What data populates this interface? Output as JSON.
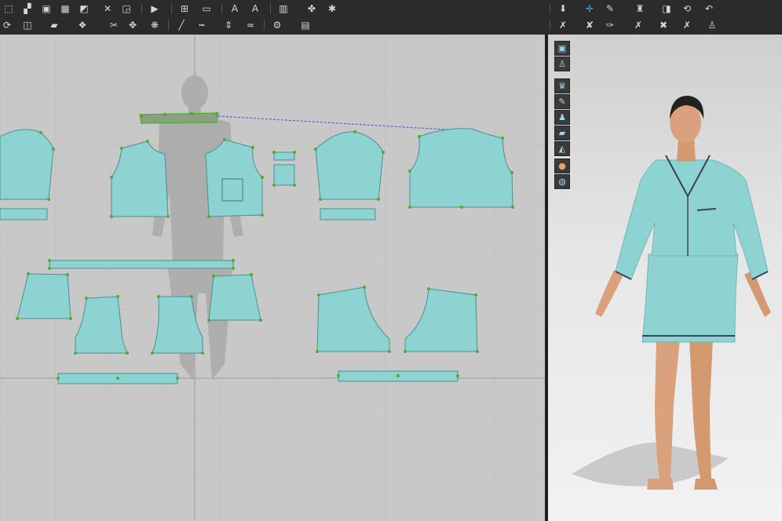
{
  "app": {
    "accent_color": "#3fb6e0",
    "fabric_color": "#8dd3d1",
    "piping_color": "#3a3f63",
    "point_color": "#4cae2a"
  },
  "toolbar": {
    "row1": [
      "select-icon",
      "move-icon",
      "image-icon",
      "grid-icon",
      "edit-point-icon",
      "cut-icon",
      "trace-icon",
      "fold-icon",
      "ruler-icon",
      "measure-icon",
      "text-icon",
      "font-icon",
      "notch-icon",
      "brush-icon",
      "bug-icon",
      "arrow-down-icon",
      "add-point-icon",
      "pin-icon",
      "garment-icon",
      "layer-icon",
      "rotate-icon",
      "undo-icon"
    ],
    "row2": [
      "wrap-icon",
      "rotate-piece-icon",
      "shirt-icon",
      "piece-icon",
      "sew-icon",
      "fabric-icon",
      "segment-line-icon",
      "dash-line-icon",
      "seam-allowance-icon",
      "measure-tape-icon",
      "avatar-icon",
      "table-icon",
      "simulate-icon",
      "tack-icon",
      "fold-arrange-icon",
      "strengthen-icon",
      "cut-garment-icon",
      "sew-avatar-icon"
    ]
  },
  "avatar_tools": [
    "view-icon",
    "shirt-view-icon",
    "fabric-view-icon",
    "paint-icon",
    "avatar-display-icon",
    "texture-icon",
    "render-icon",
    "skin-icon",
    "globe-icon"
  ]
}
